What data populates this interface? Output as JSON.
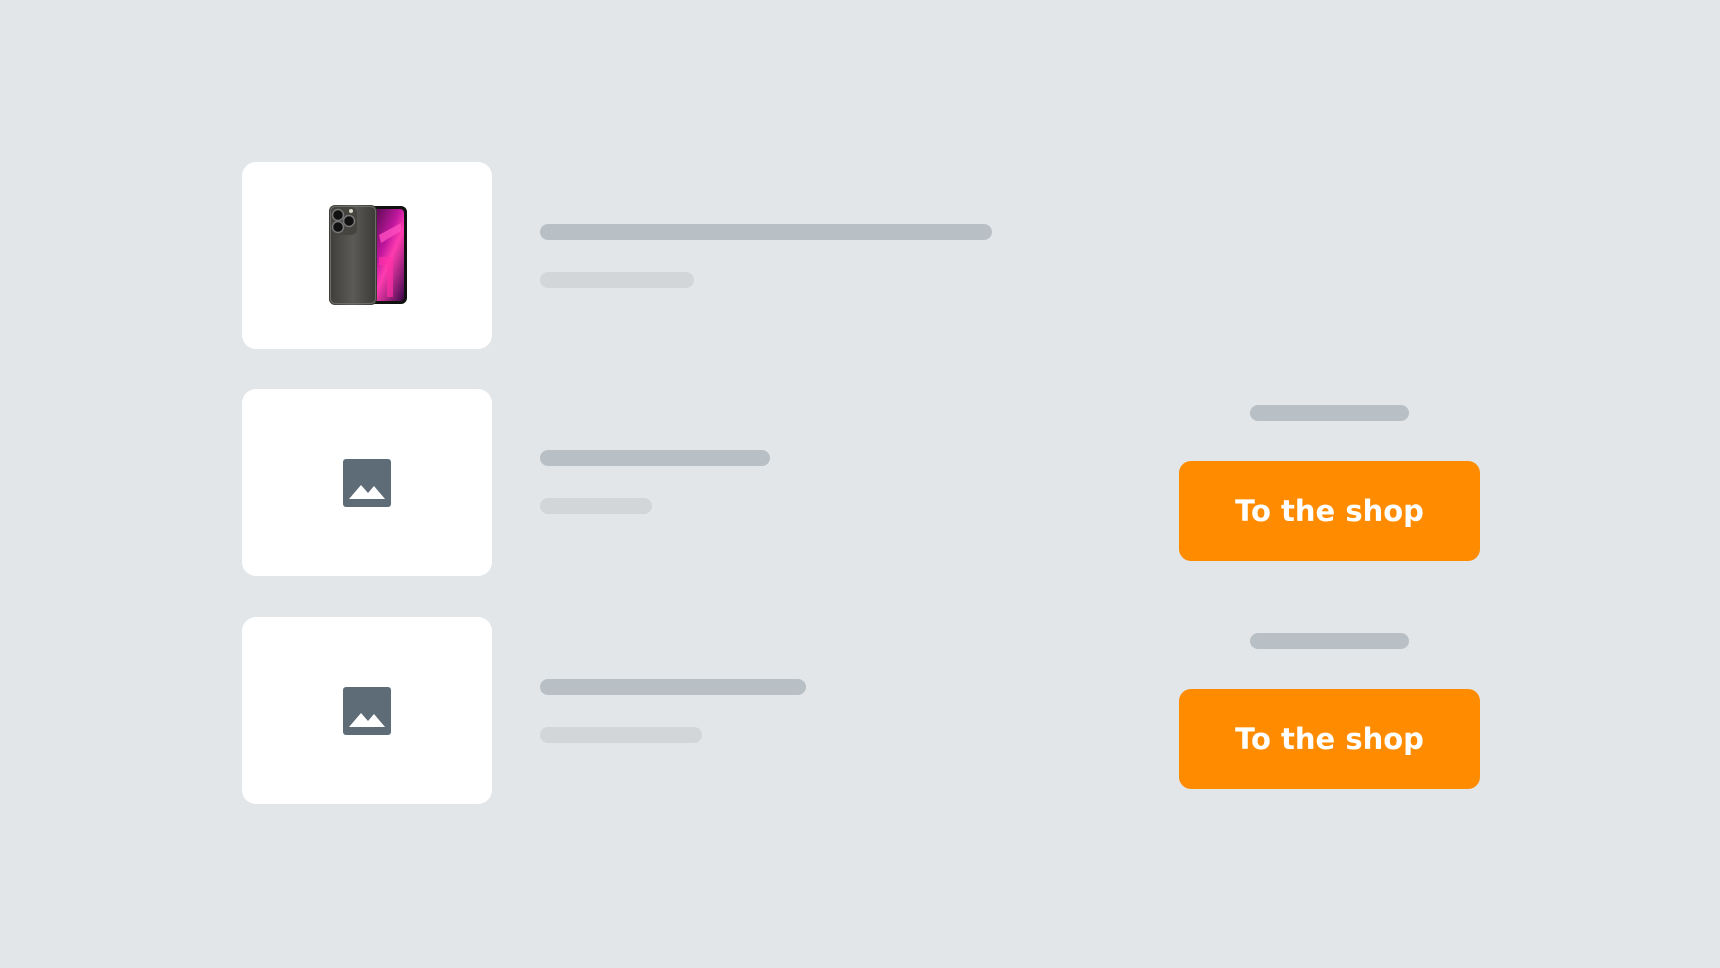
{
  "colors": {
    "background": "#e2e6e9",
    "card": "#ffffff",
    "placeholder_dark": "#b9c0c5",
    "placeholder_light": "#d2d6d9",
    "image_icon": "#5e6c78",
    "accent": "#ff8c00",
    "button_text": "#ffffff"
  },
  "products": [
    {
      "image": "smartphone-image",
      "has_button": false
    },
    {
      "image": "image-placeholder-icon",
      "has_button": true
    },
    {
      "image": "image-placeholder-icon",
      "has_button": true
    }
  ],
  "offers": [
    {
      "button_label": "To the shop"
    },
    {
      "button_label": "To the shop"
    }
  ]
}
